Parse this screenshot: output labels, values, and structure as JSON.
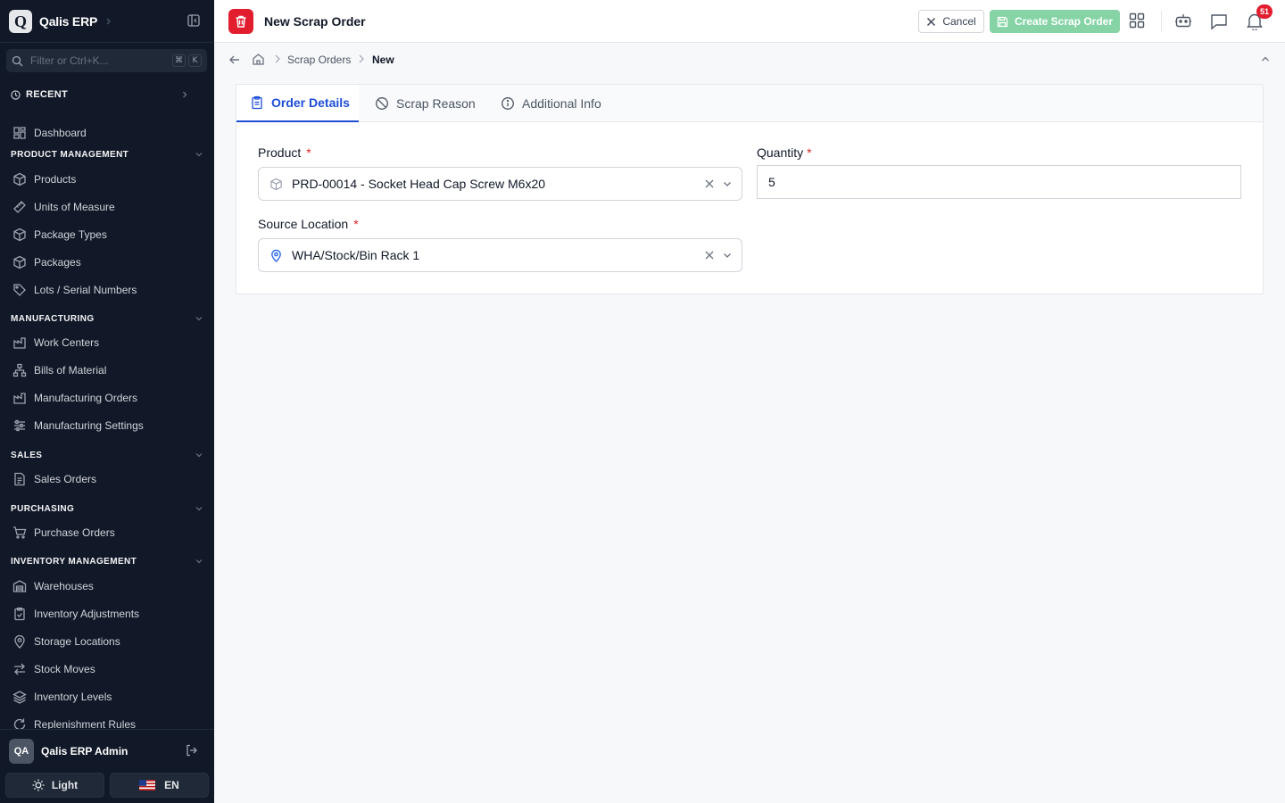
{
  "app": {
    "name": "Qalis ERP",
    "logo_letter": "Q"
  },
  "sidebar": {
    "filter_placeholder": "Filter or Ctrl+K...",
    "filter_keys": [
      "⌘",
      "K"
    ],
    "recent_label": "RECENT",
    "dashboard": "Dashboard",
    "sections": [
      {
        "title": "PRODUCT MANAGEMENT",
        "items": [
          "Products",
          "Units of Measure",
          "Package Types",
          "Packages",
          "Lots / Serial Numbers"
        ]
      },
      {
        "title": "MANUFACTURING",
        "items": [
          "Work Centers",
          "Bills of Material",
          "Manufacturing Orders",
          "Manufacturing Settings"
        ]
      },
      {
        "title": "SALES",
        "items": [
          "Sales Orders"
        ]
      },
      {
        "title": "PURCHASING",
        "items": [
          "Purchase Orders"
        ]
      },
      {
        "title": "INVENTORY MANAGEMENT",
        "items": [
          "Warehouses",
          "Inventory Adjustments",
          "Storage Locations",
          "Stock Moves",
          "Inventory Levels",
          "Replenishment Rules"
        ]
      }
    ],
    "user": {
      "initials": "QA",
      "name": "Qalis ERP Admin"
    },
    "theme_label": "Light",
    "language_label": "EN"
  },
  "header": {
    "title": "New Scrap Order",
    "cancel_label": "Cancel",
    "create_label": "Create Scrap Order",
    "notification_count": "51"
  },
  "breadcrumb": {
    "link": "Scrap Orders",
    "current": "New"
  },
  "tabs": [
    "Order Details",
    "Scrap Reason",
    "Additional Info"
  ],
  "form": {
    "product_label": "Product",
    "product_value": "PRD-00014 - Socket Head Cap Screw M6x20",
    "quantity_label": "Quantity",
    "quantity_value": "5",
    "location_label": "Source Location",
    "location_value": "WHA/Stock/Bin Rack 1",
    "required_mark": "*"
  },
  "colors": {
    "sidebar_bg": "#111827",
    "accent": "#1d4ed8",
    "danger": "#e11d2e",
    "create_button": "#86d4a6"
  }
}
